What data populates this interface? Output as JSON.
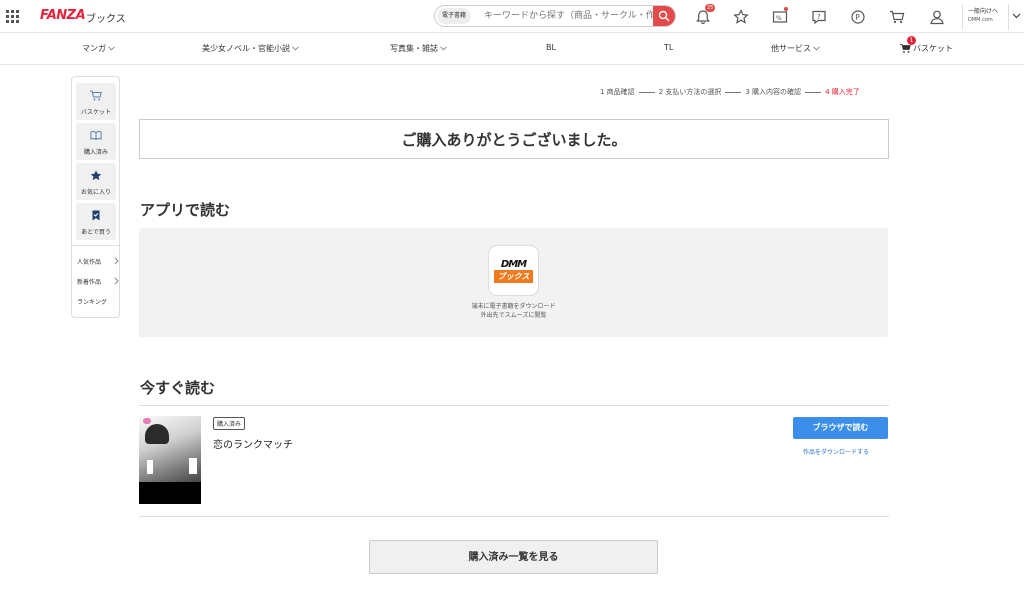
{
  "header": {
    "logo": "FANZA",
    "logo_sub": "ブックス",
    "search_category": "電子書籍",
    "search_placeholder": "キーワードから探す（商品・サークル・作者など）",
    "notification_count": "25",
    "dmm_line1": "一般向けへ",
    "dmm_line2": "DMM.com"
  },
  "nav": {
    "manga": "マンガ",
    "novel": "美少女ノベル・官能小説",
    "photo": "写真集・雑誌",
    "bl": "BL",
    "tl": "TL",
    "other": "他サービス",
    "basket": "バスケット",
    "basket_count": "1"
  },
  "sidebar": {
    "basket": "バスケット",
    "purchased": "購入済み",
    "favorites": "お気に入り",
    "later": "あとで買う",
    "popular": "人気作品",
    "new": "新着作品",
    "ranking": "ランキング"
  },
  "steps": {
    "s1": "1 商品確認",
    "s2": "2 支払い方法の選択",
    "s3": "3 購入内容の確認",
    "s4": "4 購入完了"
  },
  "main": {
    "thanks": "ご購入ありがとうございました。",
    "app_title": "アプリで読む",
    "app_logo_top": "DMM",
    "app_logo_bottom": "ブックス",
    "app_desc1": "端末に電子書籍をダウンロード",
    "app_desc2": "外出先でスムーズに閲覧",
    "read_now_title": "今すぐ読む",
    "purchased_badge": "購入済み",
    "book_title": "恋のランクマッチ",
    "browser_read": "ブラウザで読む",
    "download": "作品をダウンロードする",
    "purchased_list": "購入済み一覧を見る"
  },
  "colors": {
    "brand": "#e6233b",
    "accent_blue": "#3b8fea",
    "app_orange": "#f07b1e"
  }
}
